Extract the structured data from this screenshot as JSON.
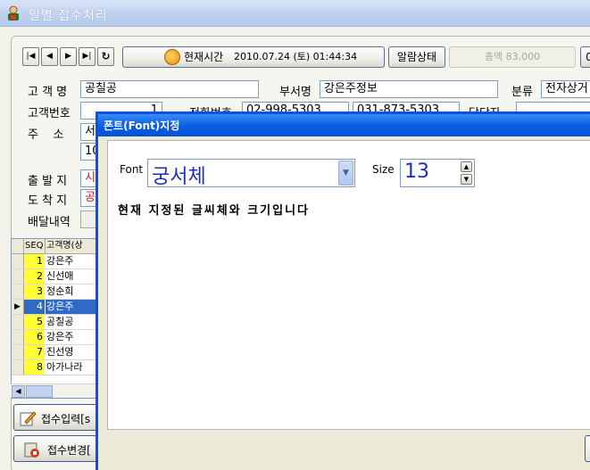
{
  "window": {
    "title": "일별 접수처리"
  },
  "toolbar": {
    "nav": [
      "first",
      "prev",
      "next",
      "last",
      "refresh"
    ],
    "time_label": "현재시간",
    "time_value": "2010.07.24 (토) 01:44:34",
    "alarm_label": "알람상태",
    "amount_text": "총액 83,000",
    "edge_label": "0"
  },
  "form": {
    "customer_name_label": "고 객 명",
    "customer_name": "공칠공",
    "dept_label": "부서명",
    "dept": "강은주정보",
    "category_label": "분류",
    "category": "전자상거",
    "customer_no_label": "고객번호",
    "customer_no": "1",
    "phone_label": "전화번호",
    "phone1": "02-998-5303",
    "phone2": "031-873-5303",
    "manager_label": "담당자",
    "address_label": "주    소",
    "address": "서",
    "address_line2": "10",
    "origin_label": "출 발 지",
    "origin": "시",
    "destination_label": "도 착 지",
    "destination": "공",
    "delivery_label": "배달내역"
  },
  "grid": {
    "headers": [
      "SEQ",
      "고객명(상"
    ],
    "rows": [
      {
        "seq": "1",
        "name": "강은주"
      },
      {
        "seq": "2",
        "name": "신선애"
      },
      {
        "seq": "3",
        "name": "정순희"
      },
      {
        "seq": "4",
        "name": "강은주"
      },
      {
        "seq": "5",
        "name": "공칠공"
      },
      {
        "seq": "6",
        "name": "강은주"
      },
      {
        "seq": "7",
        "name": "진선영"
      },
      {
        "seq": "8",
        "name": "아가나라"
      }
    ],
    "selected_row": "4"
  },
  "buttons": {
    "receive_input": "접수입력[s",
    "receive_change": "접수변경["
  },
  "dialog": {
    "title": "폰트(Font)지정",
    "font_label": "Font",
    "font_value": "궁서체",
    "size_label": "Size",
    "size_value": "13",
    "preview_text": "현재 지정된 글씨체와 크기입니다"
  },
  "colors": {
    "dialog_title_bar": "#0a5fe3",
    "selected_row": "#316ac5",
    "seq_cell": "#ffff33",
    "value_text": "#1d2fb8"
  }
}
